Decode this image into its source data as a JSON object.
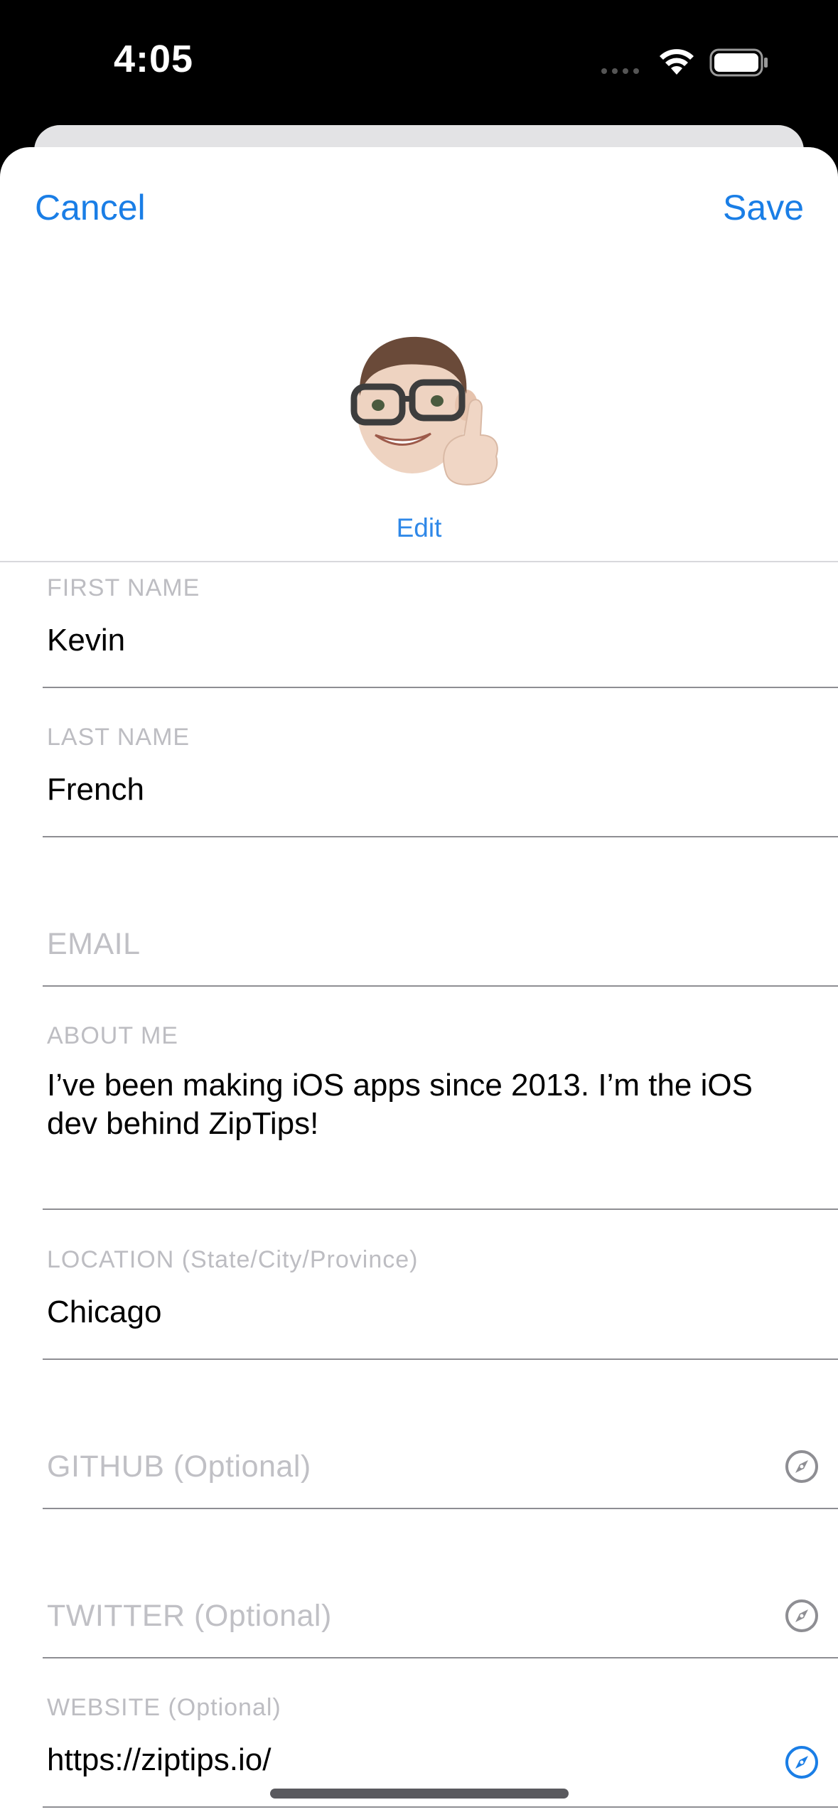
{
  "status_bar": {
    "time": "4:05"
  },
  "nav": {
    "cancel_label": "Cancel",
    "save_label": "Save"
  },
  "avatar": {
    "edit_label": "Edit"
  },
  "form": {
    "first_name": {
      "label": "FIRST NAME",
      "value": "Kevin"
    },
    "last_name": {
      "label": "LAST NAME",
      "value": "French"
    },
    "email": {
      "placeholder": "EMAIL"
    },
    "about_me": {
      "label": "ABOUT ME",
      "value": "I’ve been making iOS apps since 2013. I’m the iOS dev behind ZipTips!"
    },
    "location": {
      "label": "LOCATION (State/City/Province)",
      "value": "Chicago"
    },
    "github": {
      "placeholder": "GITHUB (Optional)"
    },
    "twitter": {
      "placeholder": "TWITTER (Optional)"
    },
    "website": {
      "label": "WEBSITE (Optional)",
      "value": "https://ziptips.io/"
    }
  },
  "colors": {
    "accent": "#1a7ee6",
    "placeholder": "#c0c0c5",
    "divider": "#8e8e93",
    "compass_inactive": "#8e8e93",
    "compass_active": "#1a7ee6"
  },
  "icons": {
    "link_icon": "compass-icon"
  }
}
